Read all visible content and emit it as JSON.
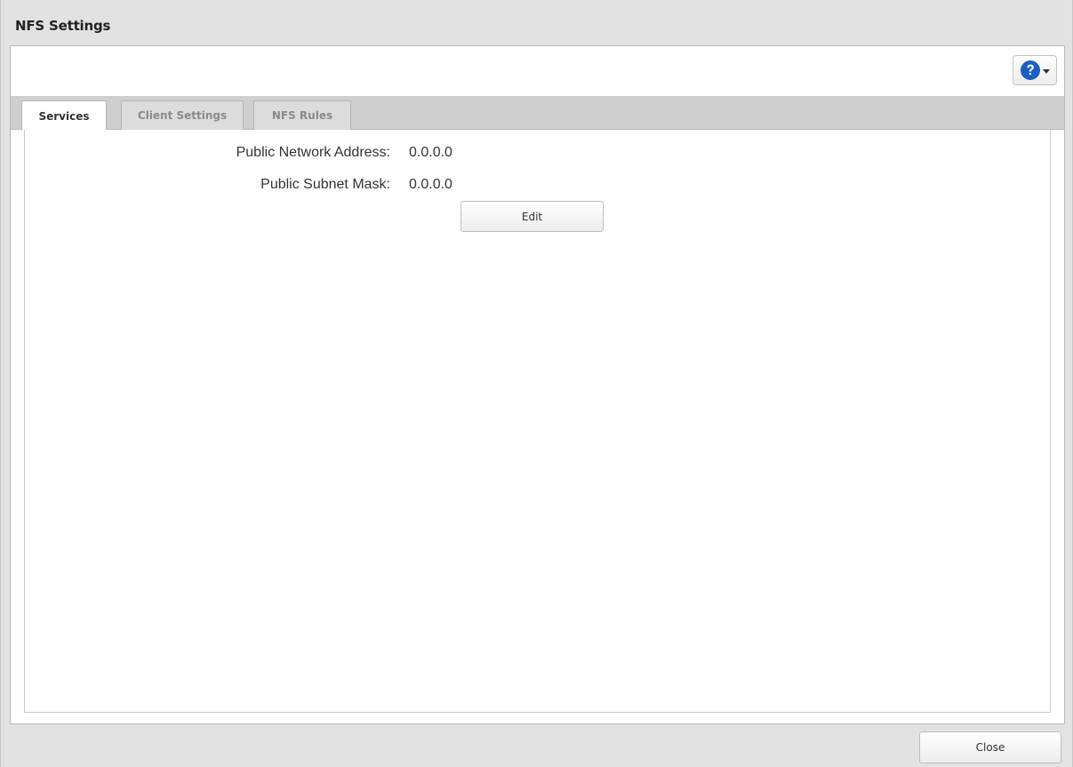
{
  "window": {
    "title": "NFS Settings"
  },
  "toolbar": {
    "help_icon": "help-icon",
    "help_dropdown_icon": "chevron-down-icon"
  },
  "tabs": [
    {
      "label": "Services",
      "active": true
    },
    {
      "label": "Client Settings",
      "active": false
    },
    {
      "label": "NFS Rules",
      "active": false
    }
  ],
  "services": {
    "public_network_address_label": "Public Network Address:",
    "public_network_address_value": "0.0.0.0",
    "public_subnet_mask_label": "Public Subnet Mask:",
    "public_subnet_mask_value": "0.0.0.0",
    "edit_label": "Edit"
  },
  "footer": {
    "close_label": "Close"
  },
  "colors": {
    "help_icon_blue": "#1a5fc4",
    "dialog_background": "#e2e2e2",
    "tab_bar_background": "#cfcfcf"
  }
}
